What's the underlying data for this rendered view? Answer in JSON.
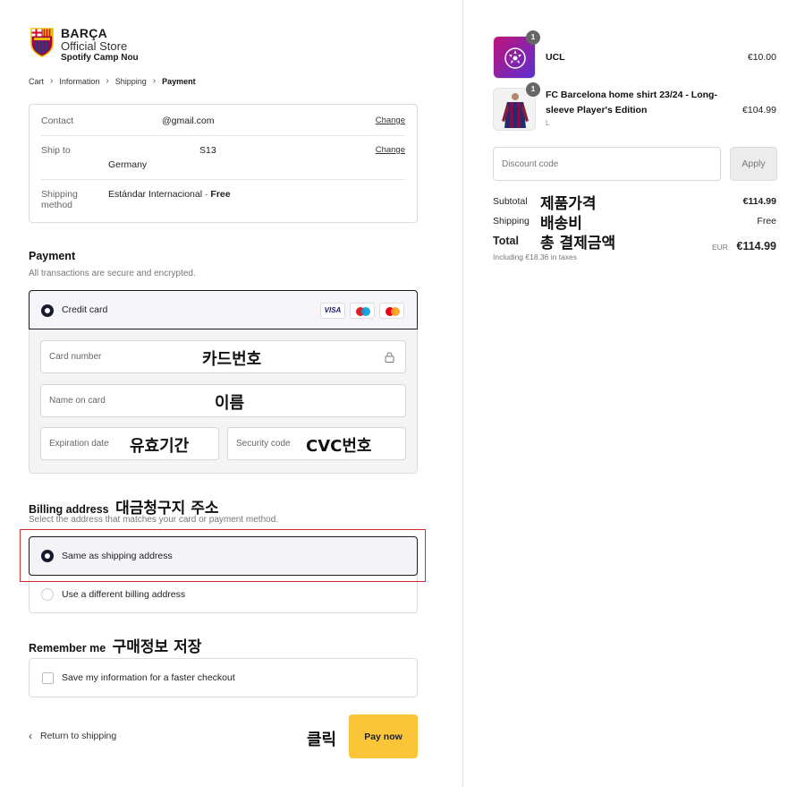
{
  "brand": {
    "name": "BARÇA",
    "store": "Official Store",
    "venue": "Spotify Camp Nou"
  },
  "breadcrumb": [
    "Cart",
    "Information",
    "Shipping",
    "Payment"
  ],
  "summary": {
    "contact_label": "Contact",
    "contact_value": "@gmail.com",
    "ship_to_label": "Ship to",
    "ship_to_value_line1": "S13",
    "ship_to_value_line2": "Germany",
    "shipping_method_label_1": "Shipping",
    "shipping_method_label_2": "method",
    "shipping_method_value": "Estándar Internacional · ",
    "shipping_method_free": "Free",
    "change_label": "Change"
  },
  "payment": {
    "title": "Payment",
    "subtitle": "All transactions are secure and encrypted.",
    "credit_card_label": "Credit card",
    "visa_label": "VISA",
    "card_number_placeholder": "Card number",
    "card_number_note": "카드번호",
    "name_placeholder": "Name on card",
    "name_note": "이름",
    "expiration_placeholder": "Expiration date",
    "expiration_note": "유효기간",
    "security_placeholder": "Security code",
    "security_note": "CVC번호"
  },
  "billing": {
    "title": "Billing address",
    "title_note": "대금청구지 주소",
    "subtitle": "Select the address that matches your card or payment method.",
    "option_same": "Same as shipping address",
    "option_different": "Use a different billing address"
  },
  "remember": {
    "title": "Remember me",
    "title_note": "구매정보 저장",
    "checkbox_label": "Save my information for a faster checkout"
  },
  "footer": {
    "return_label": "Return to shipping",
    "click_note": "클릭",
    "pay_label": "Pay now"
  },
  "cart": {
    "items": [
      {
        "name": "UCL",
        "price": "€10.00",
        "qty": "1"
      },
      {
        "name_line1": "FC Barcelona home shirt 23/24 - Long-",
        "name_line2": "sleeve Player's Edition",
        "size": "L",
        "price": "€104.99",
        "qty": "1"
      }
    ],
    "discount_placeholder": "Discount code",
    "apply_label": "Apply",
    "subtotal_label": "Subtotal",
    "subtotal_note": "제품가격",
    "subtotal_value": "€114.99",
    "shipping_label": "Shipping",
    "shipping_note": "배송비",
    "shipping_value": "Free",
    "total_label": "Total",
    "total_note": "총 결제금액",
    "currency": "EUR",
    "total_value": "€114.99",
    "taxes_note": "Including €18.36 in taxes"
  },
  "colors": {
    "pay_button": "#fbc53a",
    "highlight_border": "#d12b2b",
    "selected_radio": "#1a1a2e"
  }
}
